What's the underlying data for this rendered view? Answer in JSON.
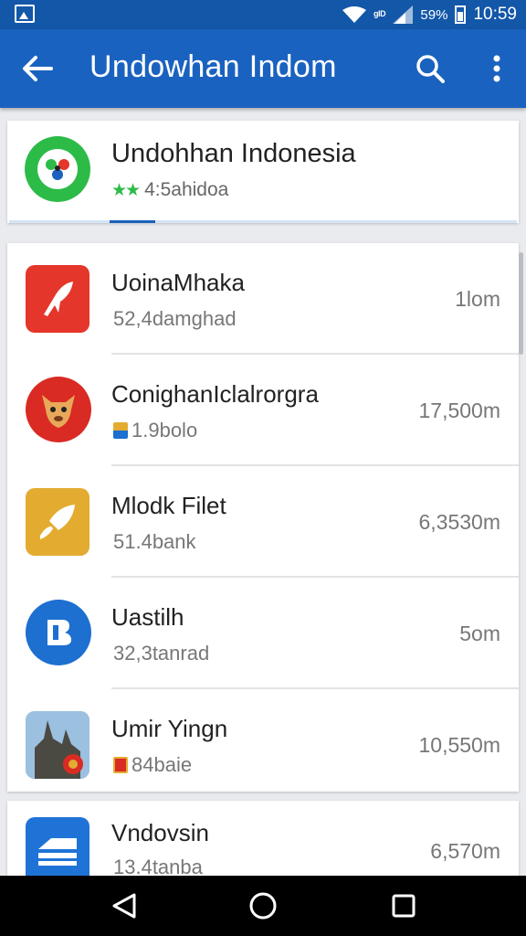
{
  "status_bar": {
    "carrier": "ᵍᴵᴰ",
    "battery_percent": "59%",
    "time": "10:59"
  },
  "toolbar": {
    "title": "Undowhan Indom"
  },
  "header": {
    "title": "Undohhan Indonesia",
    "subtitle": "4:5ahidoa"
  },
  "apps": [
    {
      "name": "UoinaMhaka",
      "sub": "52,4damghad",
      "size": "1lom",
      "color": "#e4362a",
      "icon": "squid-icon"
    },
    {
      "name": "ConighanIclalrorgra",
      "sub": "1.9bolo",
      "size": "17,500m",
      "color": "#d92b23",
      "icon": "kangaroo-icon"
    },
    {
      "name": "Mlodk Filet",
      "sub": "51.4bank",
      "size": "6,3530m",
      "color": "#e3ac31",
      "icon": "rocket-icon"
    },
    {
      "name": "Uastilh",
      "sub": "32,3tanrad",
      "size": "5om",
      "color": "#1d6fd0",
      "icon": "b-logo-icon"
    },
    {
      "name": "Umir Yingn",
      "sub": "84baie",
      "size": "10,550m",
      "color": "#5f7f3c",
      "icon": "temple-icon"
    },
    {
      "name": "Vndovsin",
      "sub": "13.4tanba",
      "size": "6,570m",
      "color": "#1f73d6",
      "icon": "sofa-icon"
    }
  ],
  "colors": {
    "toolbar": "#1a62bf",
    "status_bar": "#1357a8",
    "accent_green": "#2dbb48"
  }
}
